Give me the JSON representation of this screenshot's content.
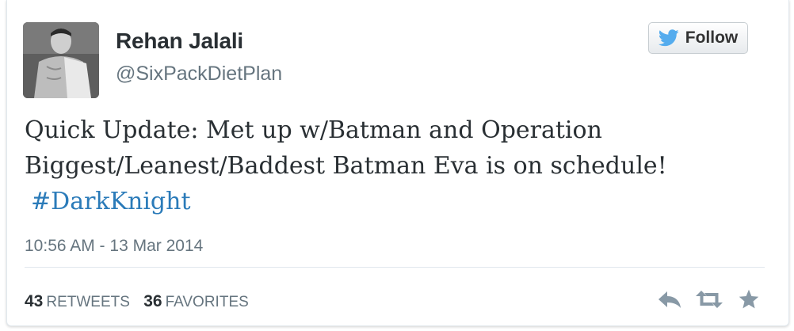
{
  "tweet": {
    "author": {
      "name": "Rehan Jalali",
      "handle": "@SixPackDietPlan",
      "avatar_icon": "profile-photo"
    },
    "follow_label": "Follow",
    "text": "Quick Update: Met up w/Batman and Operation Biggest/Leanest/Baddest Batman Eva is on schedule!",
    "hashtag": "#DarkKnight",
    "timestamp": "10:56 AM - 13 Mar 2014",
    "stats": {
      "retweets_count": "43",
      "retweets_label": "RETWEETS",
      "favorites_count": "36",
      "favorites_label": "FAVORITES"
    },
    "actions": [
      "reply-icon",
      "retweet-icon",
      "favorite-icon"
    ]
  },
  "colors": {
    "text_primary": "#292f33",
    "text_secondary": "#66757f",
    "hashtag": "#2b7bb9",
    "twitter_bird": "#55acee",
    "icon_gray": "#8899a6"
  }
}
